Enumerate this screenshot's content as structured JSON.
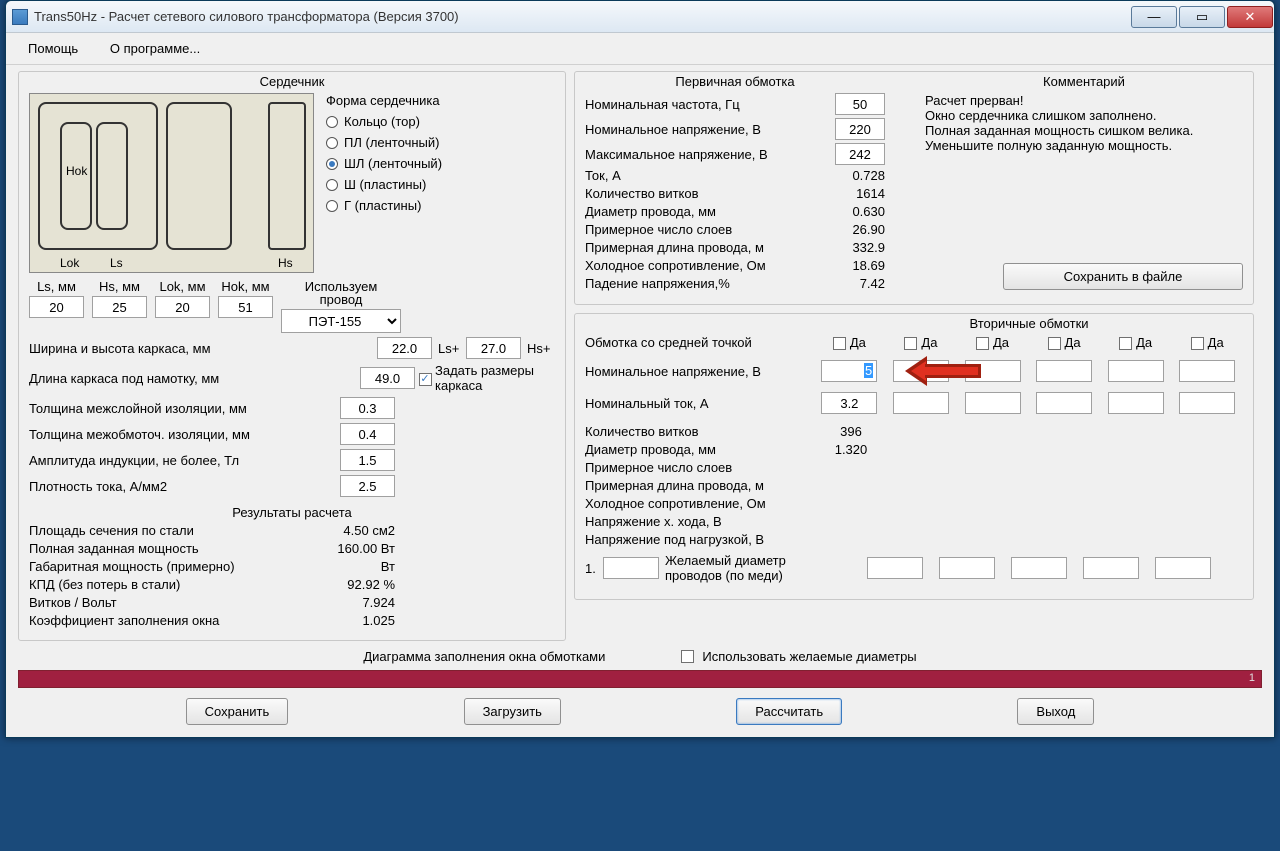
{
  "window": {
    "title": "Trans50Hz - Расчет сетевого силового трансформатора (Версия 3700)"
  },
  "menu": {
    "help": "Помощь",
    "about": "О программе..."
  },
  "core": {
    "title": "Сердечник",
    "shape_label": "Форма сердечника",
    "shapes": {
      "ring": "Кольцо (тор)",
      "pl": "ПЛ (ленточный)",
      "shl": "ШЛ (ленточный)",
      "sh": "Ш  (пластины)",
      "g": "Г (пластины)"
    },
    "dim_labels": {
      "ls": "Ls, мм",
      "hs": "Hs, мм",
      "lok": "Lok, мм",
      "hok": "Hok, мм"
    },
    "dims": {
      "ls": "20",
      "hs": "25",
      "lok": "20",
      "hok": "51"
    },
    "wire_hdr1": "Используем",
    "wire_hdr2": "провод",
    "wire": "ПЭТ-155",
    "frame_wh_label": "Ширина и высота каркаса, мм",
    "frame_w": "22.0",
    "frame_h": "27.0",
    "lsplus": "Ls+",
    "hsplus": "Hs+",
    "frame_len_label": "Длина каркаса под намотку, мм",
    "frame_len": "49.0",
    "set_frame_label": "Задать размеры каркаса",
    "inter_layer_label": "Толщина межслойной изоляции, мм",
    "inter_layer": "0.3",
    "inter_wind_label": "Толщина межобмоточ. изоляции, мм",
    "inter_wind": "0.4",
    "b_max_label": "Амплитуда индукции, не более, Тл",
    "b_max": "1.5",
    "j_label": "Плотность тока, А/мм2",
    "j": "2.5"
  },
  "results": {
    "title": "Результаты расчета",
    "steel_area_l": "Площадь сечения по стали",
    "steel_area_v": "4.50 см2",
    "full_power_l": "Полная заданная мощность",
    "full_power_v": "160.00 Вт",
    "gab_power_l": "Габаритная мощность (примерно)",
    "gab_power_v": "Вт",
    "eff_l": "КПД (без потерь в стали)",
    "eff_v": "92.92 %",
    "tpv_l": "Витков / Вольт",
    "tpv_v": "7.924",
    "fill_l": "Коэффициент заполнения окна",
    "fill_v": "1.025"
  },
  "primary": {
    "title": "Первичная обмотка",
    "freq_l": "Номинальная частота, Гц",
    "freq_v": "50",
    "vnom_l": "Номинальное напряжение, В",
    "vnom_v": "220",
    "vmax_l": "Максимальное напряжение, В",
    "vmax_v": "242",
    "i_l": "Ток, А",
    "i_v": "0.728",
    "turns_l": "Количество витков",
    "turns_v": "1614",
    "dwire_l": "Диаметр провода, мм",
    "dwire_v": "0.630",
    "layers_l": "Примерное число слоев",
    "layers_v": "26.90",
    "len_l": "Примерная длина провода, м",
    "len_v": "332.9",
    "rcold_l": "Холодное сопротивление, Ом",
    "rcold_v": "18.69",
    "vdrop_l": "Падение напряжения,%",
    "vdrop_v": "7.42"
  },
  "comment": {
    "title": "Комментарий",
    "l1": "Расчет прерван!",
    "l2": "Окно сердечника слишком заполнено.",
    "l3": "Полная заданная мощность сишком велика.",
    "l4": "Уменьшите полную заданную мощность."
  },
  "save_file_btn": "Сохранить в файле",
  "secondary": {
    "title": "Вторичные обмотки",
    "tap_label": "Обмотка со средней точкой",
    "da": "Да",
    "vnom_l": "Номинальное напряжение, В",
    "vnom_1": "5",
    "inom_l": "Номинальный ток, А",
    "inom_1": "3.2",
    "turns_l": "Количество витков",
    "turns_v": "396",
    "dwire_l": "Диаметр провода, мм",
    "dwire_v": "1.320",
    "layers_l": "Примерное число слоев",
    "layers_v": "",
    "len_l": "Примерная длина провода, м",
    "len_v": "",
    "rcold_l": "Холодное сопротивление, Ом",
    "rcold_v": "",
    "vopen_l": "Напряжение х. хода, В",
    "vopen_v": "",
    "vload_l": "Напряжение под нагрузкой, В",
    "vload_v": "",
    "wish_num": "1.",
    "wish_l1": "Желаемый диаметр",
    "wish_l2": "проводов  (по меди)",
    "use_wish": "Использовать желаемые диаметры"
  },
  "diagram_label": "Диаграмма заполнения окна обмотками",
  "bar_label": "1",
  "buttons": {
    "save": "Сохранить",
    "load": "Загрузить",
    "calc": "Рассчитать",
    "exit": "Выход"
  },
  "diag_labels": {
    "hok": "Hok",
    "lok": "Lok",
    "ls": "Ls",
    "hs": "Hs"
  }
}
